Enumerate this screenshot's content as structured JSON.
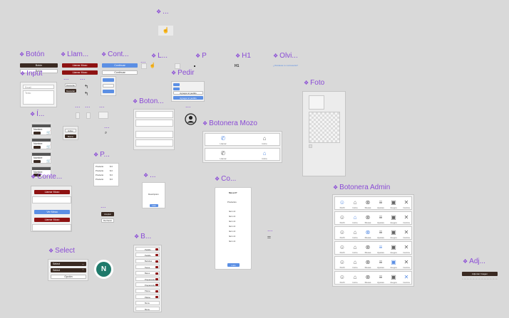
{
  "labels": {
    "top_ellipsis": "...",
    "boton": "Botón",
    "llamar": "Llam...",
    "cont": "Cont...",
    "l": "L...",
    "p": "P",
    "h1": "H1",
    "olvi": "Olvi...",
    "input": "Input",
    "pedir": "Pedir",
    "icon_i": "Í...",
    "botonera_small": "Boton...",
    "botonera_mozo": "Botonera Mozo",
    "foto": "Foto",
    "p_small": "P...",
    "conte": "Conte...",
    "ellipsis_small": "...",
    "co": "Co...",
    "botonera_admin": "Botonera Admin",
    "b": "B...",
    "select": "Select",
    "adj": "Adj..."
  },
  "boton": {
    "btn1": "Botón",
    "btn2": "Botón"
  },
  "llamar": {
    "btn1": "Llamar Mozo",
    "btn2": "Llamar Mozo"
  },
  "cont": {
    "btn1": "Continuar",
    "btn2": "Continuar"
  },
  "h1_text": "H1",
  "olvi_text": "¿Olvidaste tu contraseña?",
  "input": {
    "placeholder1": "Email",
    "placeholder2": "Texto"
  },
  "pedir": {
    "btn1": "Agregar al pedido",
    "btn2": "Agregar al pedido"
  },
  "icon_rows": [
    {
      "label": "Nombre",
      "value": "0"
    },
    {
      "label": "Nombre",
      "value": "0"
    },
    {
      "label": "Nombre",
      "value": "0"
    },
    {
      "label": "Nombre",
      "value": "0"
    }
  ],
  "icon_buttons": {
    "btn1": "Editar",
    "btn2": "Borrar"
  },
  "small_buttons": {
    "b1": "Descartar",
    "b2": "Descartar"
  },
  "botonera_mozo": {
    "items": [
      "Llamar",
      "Inicio"
    ]
  },
  "conte": {
    "btn1": "Llamar Mozo",
    "btn2": "Ver Mesa",
    "btn3": "Llamar Mozo"
  },
  "co_card": {
    "title": "Mesa N°",
    "subtitle": "Productos",
    "items": [
      "Item x1",
      "Item x1",
      "Item x1",
      "Item x1",
      "Item x1",
      "Item x1",
      "Item x1"
    ],
    "button": "Listo"
  },
  "ellipsis_card": {
    "text": "Descripcion",
    "button": "Listo"
  },
  "p_card": {
    "rows": [
      "Producto",
      "Producto",
      "Producto",
      "Producto"
    ],
    "prices": [
      "$ 0",
      "$ 0",
      "$ 0",
      "$ 0"
    ]
  },
  "mini_buttons": {
    "b1": "Aceptar",
    "b2": "Rechazar"
  },
  "b_list": [
    "Pedido",
    "Pedido",
    "Bebidas",
    "Tacos",
    "Bares",
    "Preparando",
    "Preparando",
    "Platos",
    "Platos",
    "Menu",
    "Menu"
  ],
  "select": {
    "opt1": "Select",
    "opt2": "Select",
    "opt3": "Opción"
  },
  "avatar_letter": "N",
  "adj_button": "Adjuntar Imagen",
  "admin_labels": [
    "Perfil",
    "Inicio",
    "Mesas",
    "Ajustes",
    "Juegos",
    "Cocina"
  ]
}
